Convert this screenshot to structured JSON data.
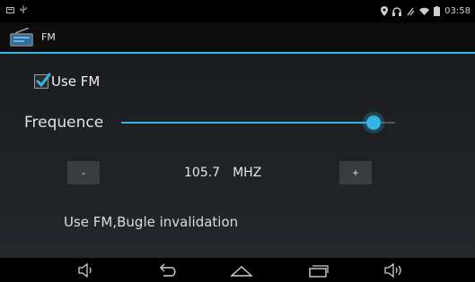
{
  "status_bar": {
    "time": "03:58",
    "icons": [
      "notification-icon",
      "usb-icon",
      "location-icon",
      "headset-icon",
      "signal-icon",
      "wifi-icon",
      "battery-icon"
    ]
  },
  "action_bar": {
    "title": "FM",
    "icon": "radio-icon"
  },
  "main": {
    "use_fm_label": "Use FM",
    "use_fm_checked": true,
    "frequence_label": "Frequence",
    "slider_level": 0.92,
    "minus_label": "-",
    "plus_label": "+",
    "frequency_value": "105.7",
    "frequency_unit": "MHZ",
    "status_message": "Use FM,Bugle invalidation"
  },
  "nav_bar": {
    "buttons": [
      "volume-down-icon",
      "back-icon",
      "home-icon",
      "recent-apps-icon",
      "volume-up-icon"
    ]
  },
  "colors": {
    "accent": "#33b5e5",
    "background": "#1e2124"
  }
}
